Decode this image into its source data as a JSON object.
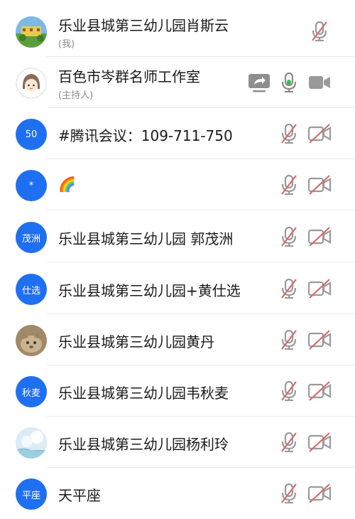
{
  "colors": {
    "accent": "#1f6ff2",
    "mic_active": "#31c24a",
    "muted": "#d56a6a",
    "icon_gray": "#9a9a9a"
  },
  "participants": [
    {
      "avatar": {
        "kind": "photo",
        "icon": "school-photo-avatar"
      },
      "name": "乐业县城第三幼儿园肖斯云",
      "subtitle": "(我)",
      "icons": {
        "share": false,
        "mic": "muted",
        "video": "none"
      }
    },
    {
      "avatar": {
        "kind": "photo",
        "icon": "cartoon-girl-avatar"
      },
      "name": "百色市岑群名师工作室",
      "subtitle": "(主持人)",
      "icons": {
        "share": true,
        "mic": "active",
        "video": "on"
      }
    },
    {
      "avatar": {
        "kind": "text",
        "text": "50"
      },
      "name": "#腾讯会议：109-711-750",
      "subtitle": "",
      "icons": {
        "share": false,
        "mic": "muted",
        "video": "off"
      }
    },
    {
      "avatar": {
        "kind": "text",
        "text": "*"
      },
      "name": "🌈",
      "subtitle": "",
      "icons": {
        "share": false,
        "mic": "muted",
        "video": "off"
      }
    },
    {
      "avatar": {
        "kind": "text",
        "text": "茂洲"
      },
      "name": "乐业县城第三幼儿园 郭茂洲",
      "subtitle": "",
      "icons": {
        "share": false,
        "mic": "muted",
        "video": "off"
      }
    },
    {
      "avatar": {
        "kind": "text",
        "text": "仕选"
      },
      "name": "乐业县城第三幼儿园+黄仕选",
      "subtitle": "",
      "icons": {
        "share": false,
        "mic": "muted",
        "video": "off"
      }
    },
    {
      "avatar": {
        "kind": "photo",
        "icon": "cat-photo-avatar"
      },
      "name": "乐业县城第三幼儿园黄丹",
      "subtitle": "",
      "icons": {
        "share": false,
        "mic": "muted",
        "video": "off"
      }
    },
    {
      "avatar": {
        "kind": "text",
        "text": "秋麦"
      },
      "name": "乐业县城第三幼儿园韦秋麦",
      "subtitle": "",
      "icons": {
        "share": false,
        "mic": "muted",
        "video": "off"
      }
    },
    {
      "avatar": {
        "kind": "photo",
        "icon": "sky-photo-avatar"
      },
      "name": "乐业县城第三幼儿园杨利玲",
      "subtitle": "",
      "icons": {
        "share": false,
        "mic": "muted",
        "video": "off"
      }
    },
    {
      "avatar": {
        "kind": "text",
        "text": "平座"
      },
      "name": "天平座",
      "subtitle": "",
      "icons": {
        "share": false,
        "mic": "muted",
        "video": "off"
      }
    }
  ]
}
